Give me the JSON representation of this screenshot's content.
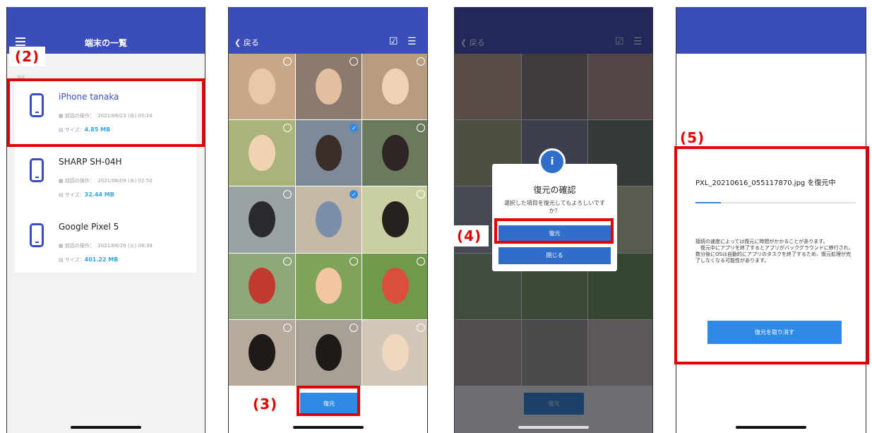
{
  "screen1": {
    "title": "端末の一覧",
    "step": "(2)",
    "section_caption": "端末",
    "devices": [
      {
        "name": "iPhone tanaka",
        "last_op_label": "前回の操作：",
        "last_op": "2021/06/23 (水) 05:24",
        "size_label": "サイズ：",
        "size": "4.85 MB"
      },
      {
        "name": "SHARP SH-04H",
        "last_op_label": "前回の操作：",
        "last_op": "2021/06/09 (水) 02:50",
        "size_label": "サイズ：",
        "size": "32.44 MB"
      },
      {
        "name": "Google Pixel 5",
        "last_op_label": "前回の操作：",
        "last_op": "2021/06/29 (火) 08:39",
        "size_label": "サイズ：",
        "size": "401.22 MB"
      }
    ]
  },
  "screen2": {
    "back_label": "戻る",
    "step": "(3)",
    "restore_label": "復元",
    "photos": [
      {
        "checked": false
      },
      {
        "checked": false
      },
      {
        "checked": false
      },
      {
        "checked": false
      },
      {
        "checked": true
      },
      {
        "checked": false
      },
      {
        "checked": false
      },
      {
        "checked": true
      },
      {
        "checked": false
      },
      {
        "checked": false
      },
      {
        "checked": false
      },
      {
        "checked": false
      },
      {
        "checked": false
      },
      {
        "checked": false
      },
      {
        "checked": false
      }
    ]
  },
  "screen3": {
    "back_label": "戻る",
    "step": "(4)",
    "dialog_icon": "i",
    "dialog_title": "復元の確認",
    "dialog_message": "選択した項目を復元してもよろしいですか？",
    "confirm_label": "復元",
    "close_label": "閉じる",
    "footer_restore_label": "復元"
  },
  "screen4": {
    "step": "(5)",
    "restoring_text": "PXL_20210616_055117870.jpg を復元中",
    "progress": 0.16,
    "info_text": "接続の速度によっては復元に時間がかかることがあります。\n　復元中にアプリを終了するとアプリがバックグラウンドに移行され、数分後にOSは自動的にアプリのタスクを終了するため、復元処理が完了しなくなる可能性があります。",
    "cancel_label": "復元を取り消す"
  },
  "colors": {
    "brand": "#3a4dbb",
    "accent": "#2f8ae5",
    "highlight": "#e30000",
    "size_text": "#36a3e6"
  }
}
